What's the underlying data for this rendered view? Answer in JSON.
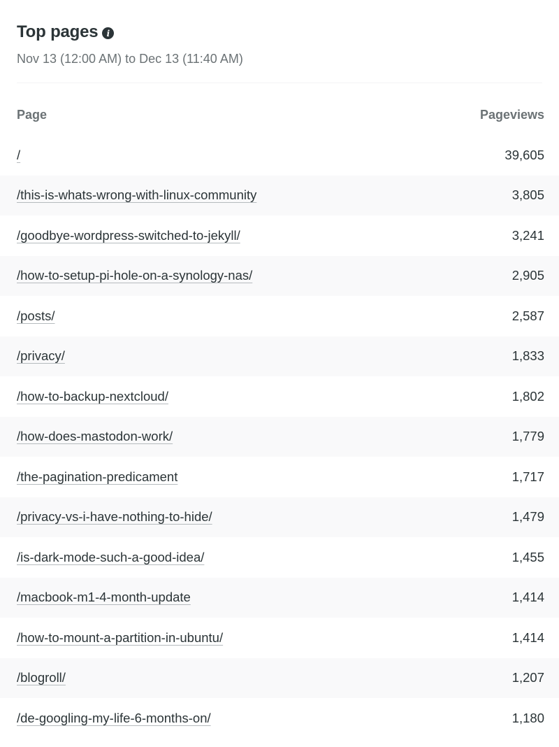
{
  "header": {
    "title": "Top pages",
    "info_icon": "info-icon",
    "date_range": "Nov 13 (12:00 AM) to Dec 13 (11:40 AM)"
  },
  "table": {
    "columns": [
      "Page",
      "Pageviews"
    ],
    "rows": [
      {
        "page": "/",
        "pageviews": "39,605"
      },
      {
        "page": "/this-is-whats-wrong-with-linux-community",
        "pageviews": "3,805"
      },
      {
        "page": "/goodbye-wordpress-switched-to-jekyll/",
        "pageviews": "3,241"
      },
      {
        "page": "/how-to-setup-pi-hole-on-a-synology-nas/",
        "pageviews": "2,905"
      },
      {
        "page": "/posts/",
        "pageviews": "2,587"
      },
      {
        "page": "/privacy/",
        "pageviews": "1,833"
      },
      {
        "page": "/how-to-backup-nextcloud/",
        "pageviews": "1,802"
      },
      {
        "page": "/how-does-mastodon-work/",
        "pageviews": "1,779"
      },
      {
        "page": "/the-pagination-predicament",
        "pageviews": "1,717"
      },
      {
        "page": "/privacy-vs-i-have-nothing-to-hide/",
        "pageviews": "1,479"
      },
      {
        "page": "/is-dark-mode-such-a-good-idea/",
        "pageviews": "1,455"
      },
      {
        "page": "/macbook-m1-4-month-update",
        "pageviews": "1,414"
      },
      {
        "page": "/how-to-mount-a-partition-in-ubuntu/",
        "pageviews": "1,414"
      },
      {
        "page": "/blogroll/",
        "pageviews": "1,207"
      },
      {
        "page": "/de-googling-my-life-6-months-on/",
        "pageviews": "1,180"
      }
    ]
  },
  "colors": {
    "text": "#2b3437",
    "muted": "#6b7275",
    "stripe": "#f9f9fa"
  }
}
